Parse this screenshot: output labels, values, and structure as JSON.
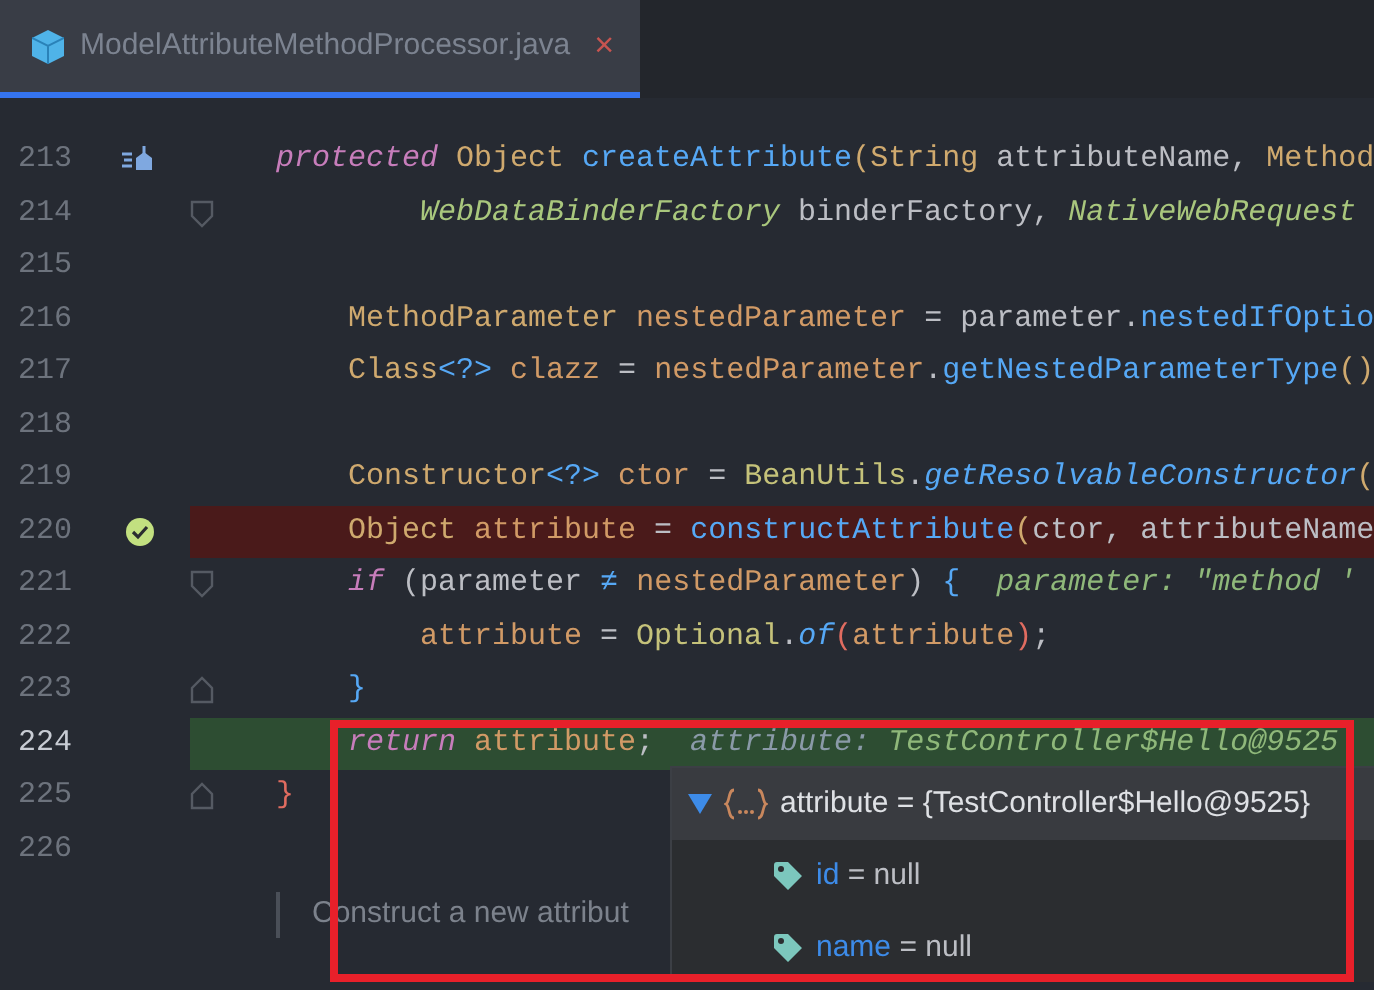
{
  "tab": {
    "title": "ModelAttributeMethodProcessor.java",
    "close": "×",
    "selected": true
  },
  "lines": [
    {
      "number": "213",
      "gutter": {
        "kind": "method-marker"
      },
      "tokens": [
        {
          "t": "protected",
          "kind": "kw"
        },
        {
          "t": " Object ",
          "kind": "type"
        },
        {
          "t": "createAttribute",
          "kind": "fn"
        },
        {
          "t": "(String ",
          "kind": "type"
        },
        {
          "t": "attributeName, ",
          "kind": "plain"
        },
        {
          "t": "Method",
          "kind": "type"
        }
      ]
    },
    {
      "number": "214",
      "fold": {
        "kind": "start"
      },
      "tokens": [
        {
          "t": "        WebDataBinderFactory",
          "kind": "itype"
        },
        {
          "t": " binderFactory, ",
          "kind": "plain"
        },
        {
          "t": "NativeWebRequest",
          "kind": "itype"
        }
      ]
    },
    {
      "number": "215"
    },
    {
      "number": "216",
      "tokens": [
        {
          "t": "    MethodParameter ",
          "kind": "type"
        },
        {
          "t": "nestedParameter",
          "kind": "local"
        },
        {
          "t": " = parameter.",
          "kind": "plain"
        },
        {
          "t": "nestedIfOptio",
          "kind": "fn"
        }
      ]
    },
    {
      "number": "217",
      "tokens": [
        {
          "t": "    Class",
          "kind": "type"
        },
        {
          "t": "<?>",
          "kind": "fn"
        },
        {
          "t": " clazz",
          "kind": "local"
        },
        {
          "t": " = ",
          "kind": "plain"
        },
        {
          "t": "nestedParameter",
          "kind": "local"
        },
        {
          "t": ".",
          "kind": "plain"
        },
        {
          "t": "getNestedParameterType",
          "kind": "fn"
        },
        {
          "t": "()",
          "kind": "type"
        }
      ]
    },
    {
      "number": "218"
    },
    {
      "number": "219",
      "tokens": [
        {
          "t": "    Constructor",
          "kind": "type"
        },
        {
          "t": "<?>",
          "kind": "fn"
        },
        {
          "t": " ctor",
          "kind": "local"
        },
        {
          "t": " = ",
          "kind": "plain"
        },
        {
          "t": "BeanUtils",
          "kind": "cls"
        },
        {
          "t": ".",
          "kind": "plain"
        },
        {
          "t": "getResolvableConstructor",
          "kind": "ifn"
        },
        {
          "t": "(",
          "kind": "type"
        }
      ]
    },
    {
      "number": "220",
      "gutter": {
        "kind": "breakpoint-verified"
      },
      "breakpoint": true,
      "tokens": [
        {
          "t": "    Object ",
          "kind": "type"
        },
        {
          "t": "attribute",
          "kind": "local"
        },
        {
          "t": " = ",
          "kind": "plain"
        },
        {
          "t": "constructAttribute",
          "kind": "fn"
        },
        {
          "t": "(",
          "kind": "type"
        },
        {
          "t": "ctor, attributeName",
          "kind": "plain"
        }
      ]
    },
    {
      "number": "221",
      "fold": {
        "kind": "start"
      },
      "tokens": [
        {
          "t": "    if",
          "kind": "kw"
        },
        {
          "t": " (parameter ",
          "kind": "plain"
        },
        {
          "t": "≠",
          "kind": "fn"
        },
        {
          "t": " nestedParameter",
          "kind": "local"
        },
        {
          "t": ") ",
          "kind": "plain"
        },
        {
          "t": "{",
          "kind": "fn"
        },
        {
          "t": "  parameter: \"method '",
          "kind": "hint"
        }
      ]
    },
    {
      "number": "222",
      "tokens": [
        {
          "t": "        attribute",
          "kind": "local"
        },
        {
          "t": " = ",
          "kind": "plain"
        },
        {
          "t": "Optional",
          "kind": "cls"
        },
        {
          "t": ".",
          "kind": "plain"
        },
        {
          "t": "of",
          "kind": "ifn"
        },
        {
          "t": "(",
          "kind": "red"
        },
        {
          "t": "attribute",
          "kind": "local"
        },
        {
          "t": ")",
          "kind": "red"
        },
        {
          "t": ";",
          "kind": "plain"
        }
      ]
    },
    {
      "number": "223",
      "fold": {
        "kind": "end"
      },
      "tokens": [
        {
          "t": "    }",
          "kind": "fn"
        }
      ]
    },
    {
      "number": "224",
      "execution_point": true,
      "tokens": [
        {
          "t": "    return",
          "kind": "kw"
        },
        {
          "t": " attribute",
          "kind": "local"
        },
        {
          "t": ";",
          "kind": "plain"
        },
        {
          "t": "  attribute: ",
          "kind": "hintlabel"
        },
        {
          "t": "TestController$Hello@9525",
          "kind": "hint"
        }
      ]
    },
    {
      "number": "225",
      "fold": {
        "kind": "end"
      },
      "tokens": [
        {
          "t": "}",
          "kind": "red"
        }
      ]
    },
    {
      "number": "226"
    }
  ],
  "doc": [
    "Construct a new attribut"
  ],
  "popup": {
    "variables": [
      {
        "name": "attribute",
        "separator": "=",
        "value": "{TestController$Hello@9525}",
        "kind": "object",
        "expanded": true,
        "children": [
          {
            "name": "id",
            "separator": "=",
            "value": "null",
            "kind": "field"
          },
          {
            "name": "name",
            "separator": "=",
            "value": "null",
            "kind": "field"
          }
        ]
      }
    ]
  }
}
